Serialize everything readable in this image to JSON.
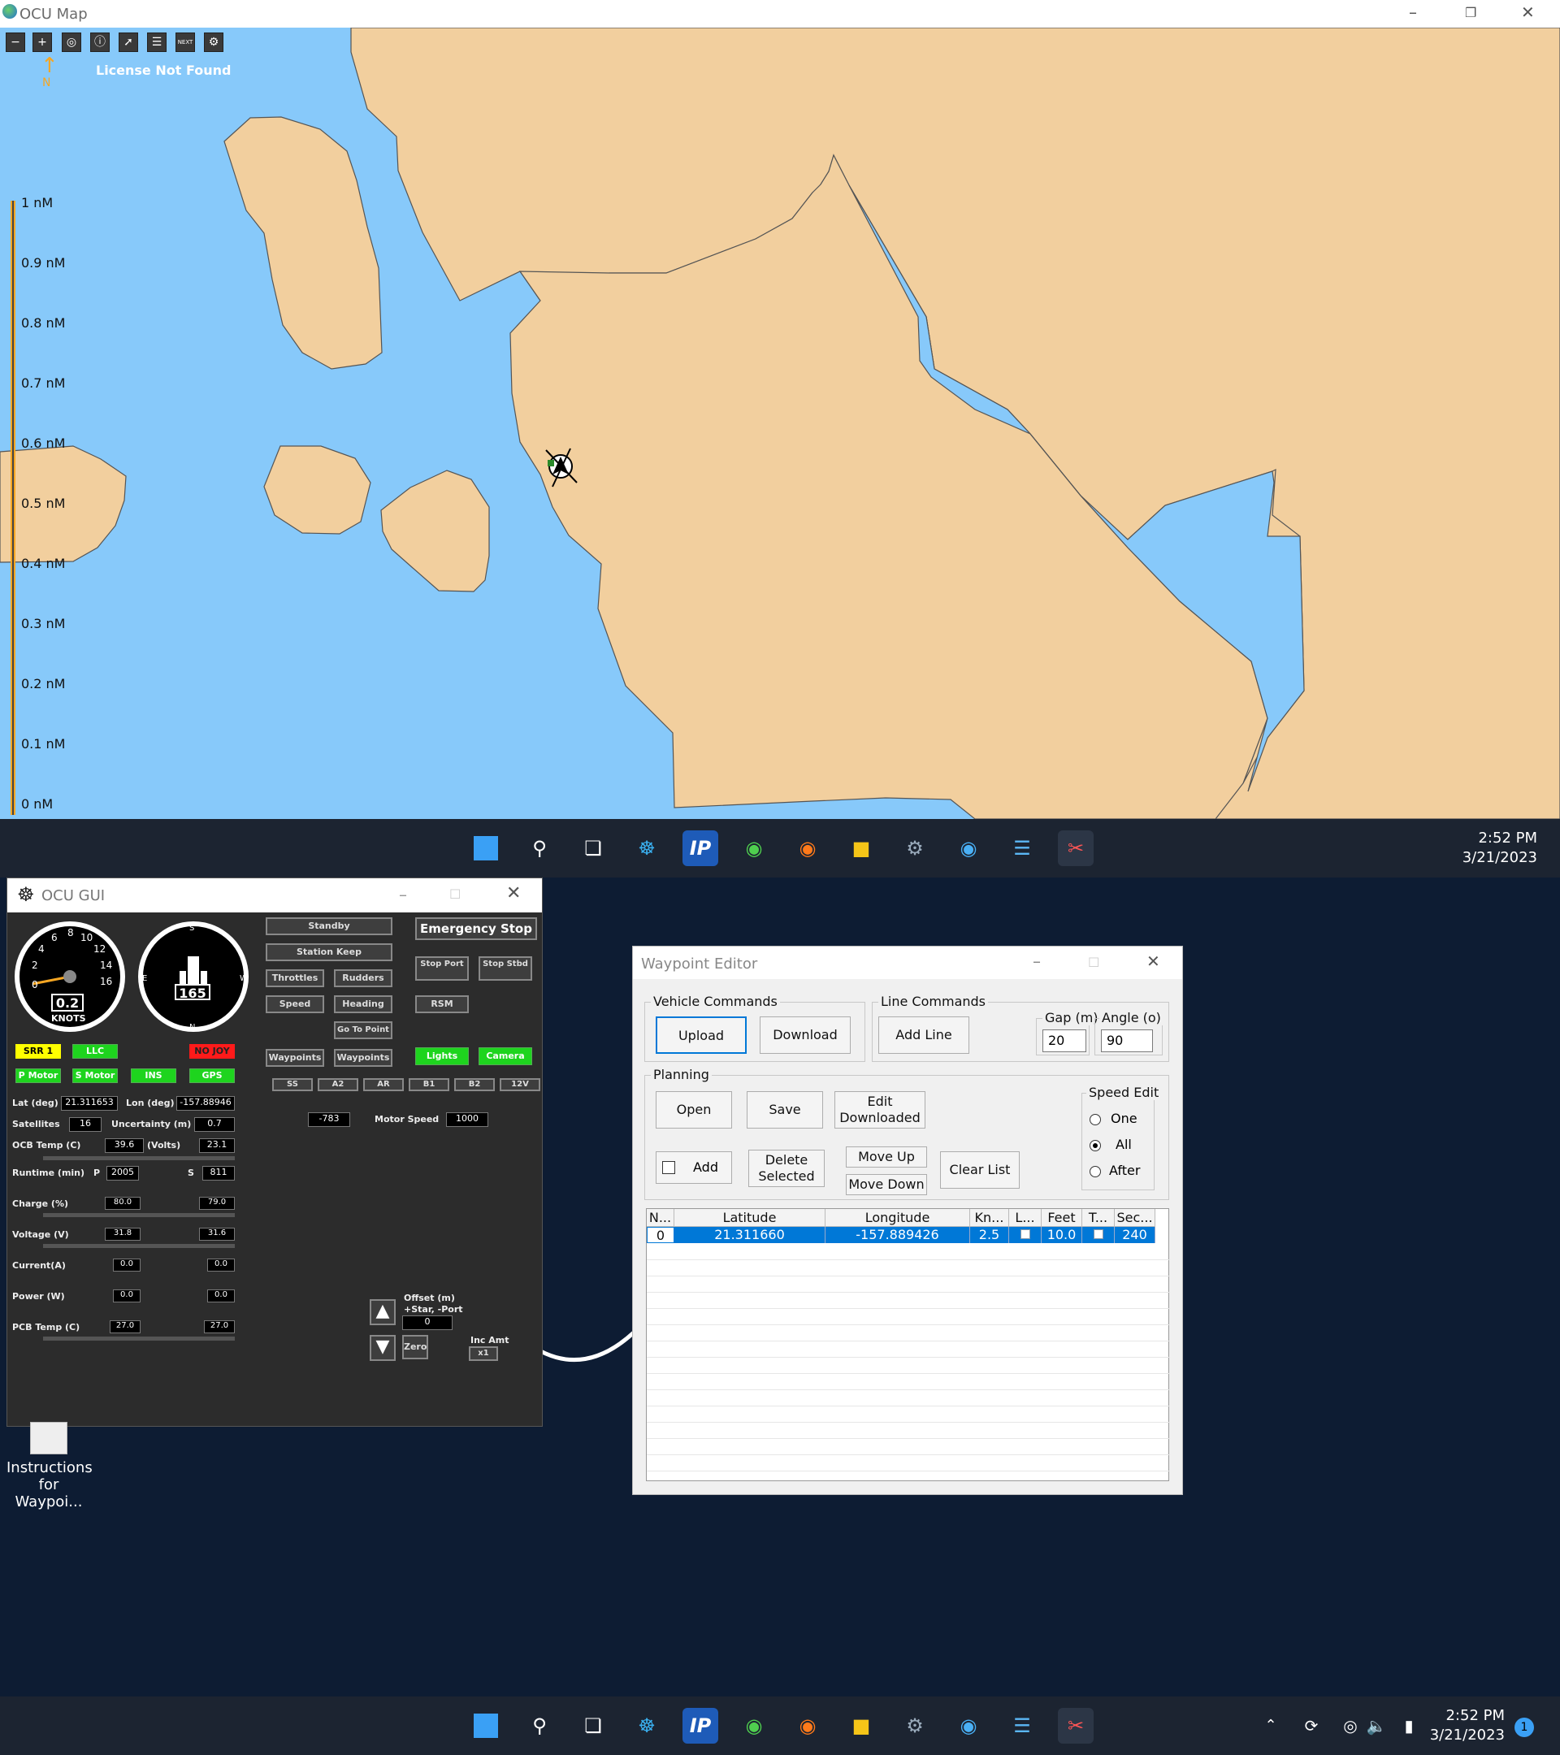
{
  "map_window": {
    "title": "OCU Map",
    "license": "License Not Found",
    "north_label": "N",
    "toolbar": [
      "zoom-out",
      "zoom-in",
      "center",
      "info",
      "route",
      "list",
      "next",
      "settings"
    ],
    "next_label": "NEXT",
    "scale_labels": [
      "1 nM",
      "0.9 nM",
      "0.8 nM",
      "0.7 nM",
      "0.6 nM",
      "0.5 nM",
      "0.4 nM",
      "0.3 nM",
      "0.2 nM",
      "0.1 nM",
      "0 nM"
    ],
    "colors": {
      "water": "#87c9fa",
      "land": "#f2cf9e",
      "scale": "#f5a623"
    }
  },
  "taskbar_top": {
    "time": "2:52 PM",
    "date": "3/21/2023"
  },
  "taskbar_bottom": {
    "time": "2:52 PM",
    "date": "3/21/2023",
    "notifications": "1"
  },
  "ocu_gui": {
    "title": "OCU GUI",
    "speed_gauge": {
      "value": "0.2",
      "unit": "KNOTS",
      "ticks": [
        "0",
        "2",
        "4",
        "6",
        "8",
        "10",
        "12",
        "14",
        "16"
      ]
    },
    "heading_gauge": {
      "value": "165",
      "ticks": [
        "30",
        "33",
        "N",
        "3",
        "6",
        "E",
        "12",
        "15",
        "S",
        "21",
        "24",
        "W"
      ]
    },
    "buttons": {
      "standby": "Standby",
      "station_keep": "Station Keep",
      "throttles": "Throttles",
      "rudders": "Rudders",
      "speed": "Speed",
      "heading": "Heading",
      "go_to_point": "Go To Point",
      "waypoints1": "Waypoints",
      "waypoints2": "Waypoints",
      "emergency": "Emergency Stop",
      "stop_port": "Stop Port",
      "stop_stbd": "Stop Stbd",
      "rsm": "RSM",
      "lights": "Lights",
      "camera": "Camera",
      "zero": "Zero",
      "inc": "x1"
    },
    "status": {
      "srr": "SRR 1",
      "llc": "LLC",
      "nojoy": "NO JOY",
      "pmotor": "P Motor",
      "smotor": "S Motor",
      "ins": "INS",
      "gps": "GPS"
    },
    "small_buttons": [
      "SS",
      "A2",
      "AR",
      "B1",
      "B2",
      "12V"
    ],
    "lat_label": "Lat (deg)",
    "lat": "21.311653",
    "lon_label": "Lon (deg)",
    "lon": "-157.88946",
    "sat_label": "Satellites",
    "sat": "16",
    "unc_label": "Uncertainty (m)",
    "unc": "0.7",
    "ocb_label": "OCB Temp (C)",
    "ocb": "39.6",
    "volts_label": "(Volts)",
    "volts": "23.1",
    "runtime_label": "Runtime (min)",
    "p_label": "P",
    "runtime_p": "2005",
    "s_label": "S",
    "runtime_s": "811",
    "charge_label": "Charge (%)",
    "charge_p": "80.0",
    "charge_s": "79.0",
    "voltage_label": "Voltage (V)",
    "voltage_p": "31.8",
    "voltage_s": "31.6",
    "current_label": "Current(A)",
    "current_p": "0.0",
    "current_s": "0.0",
    "power_label": "Power (W)",
    "power_p": "0.0",
    "power_s": "0.0",
    "pcb_label": "PCB Temp (C)",
    "pcb_p": "27.0",
    "pcb_s": "27.0",
    "rudder_val": "-783",
    "motor_speed_label": "Motor Speed",
    "motor_speed": "1000",
    "offset_label": "Offset (m)",
    "offset_sub": "+Star, -Port",
    "offset": "0",
    "inc_label": "Inc Amt"
  },
  "waypoint_editor": {
    "title": "Waypoint Editor",
    "vehicle_commands": "Vehicle Commands",
    "upload": "Upload",
    "download": "Download",
    "line_commands": "Line Commands",
    "add_line": "Add Line",
    "gap_label": "Gap (m)",
    "gap": "20",
    "angle_label": "Angle (o)",
    "angle": "90",
    "planning": "Planning",
    "open": "Open",
    "save": "Save",
    "edit_downloaded": "Edit Downloaded",
    "add": "Add",
    "delete_selected": "Delete Selected",
    "move_up": "Move Up",
    "move_down": "Move Down",
    "clear_list": "Clear List",
    "speed_edit": "Speed Edit",
    "one": "One",
    "all": "All",
    "after": "After",
    "speed_edit_selected": "All",
    "columns": [
      "N...",
      "Latitude",
      "Longitude",
      "Kn...",
      "L...",
      "Feet",
      "T...",
      "Sec..."
    ],
    "rows": [
      {
        "n": "0",
        "lat": "21.311660",
        "lon": "-157.889426",
        "kn": "2.5",
        "feet": "10.0",
        "sec": "240"
      }
    ]
  },
  "desktop": {
    "icon_label": "Instructions for Waypoi..."
  }
}
